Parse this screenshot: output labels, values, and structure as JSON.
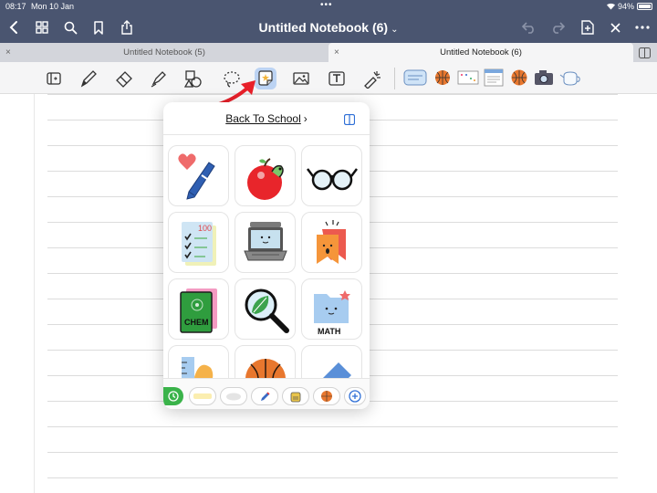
{
  "status_bar": {
    "time": "08:17",
    "date": "Mon 10 Jan",
    "battery": "94%"
  },
  "nav": {
    "title": "Untitled Notebook (6)",
    "title_chevron": "⌄",
    "left_icons": [
      "back-icon",
      "grid-icon",
      "search-icon",
      "bookmark-icon",
      "share-icon"
    ],
    "right_icons": [
      "undo-icon",
      "redo-icon",
      "add-page-icon",
      "close-icon",
      "more-icon"
    ]
  },
  "tabs": [
    {
      "label": "Untitled Notebook (5)",
      "active": false,
      "close": "×"
    },
    {
      "label": "Untitled Notebook (6)",
      "active": true,
      "close": "×"
    }
  ],
  "toolbar": {
    "tools": [
      "reading-mode-icon",
      "pen-icon",
      "eraser-icon",
      "highlighter-icon",
      "shapes-icon",
      "lasso-icon",
      "sticker-icon",
      "image-icon",
      "text-icon",
      "laser-pointer-icon"
    ],
    "selected_tool": "sticker-icon",
    "sticker_favorites": [
      "teacher-sticker",
      "basketball-sticker",
      "calendar-sticker",
      "notes-sticker",
      "basketball-sticker",
      "camera-sticker",
      "teapot-sticker"
    ]
  },
  "popover": {
    "title": "Back To School",
    "title_chevron": "›",
    "stickers": [
      "heart-pen-sticker",
      "apple-worm-sticker",
      "glasses-sticker",
      "checklist-sticker",
      "laptop-sticker",
      "bookmark-sticker",
      "chem-book-sticker",
      "magnifier-leaf-sticker",
      "math-folder-sticker",
      "ruler-leaf-sticker",
      "basketball-sticker",
      "eraser-sticker"
    ],
    "sticker_texts": {
      "chem": "CHEM",
      "math": "MATH"
    },
    "categories": [
      "recent",
      "washi-tape",
      "cloud",
      "pencil",
      "school-bag",
      "basketball",
      "add"
    ]
  },
  "colors": {
    "header": "#4a5570",
    "tab_bar": "#d3d5db",
    "toolbar": "#f5f5f6",
    "selected_tool": "#bcd3f3",
    "arrow": "#e8202a",
    "recent_green": "#3ab34a",
    "add_blue": "#2f6fd6"
  }
}
